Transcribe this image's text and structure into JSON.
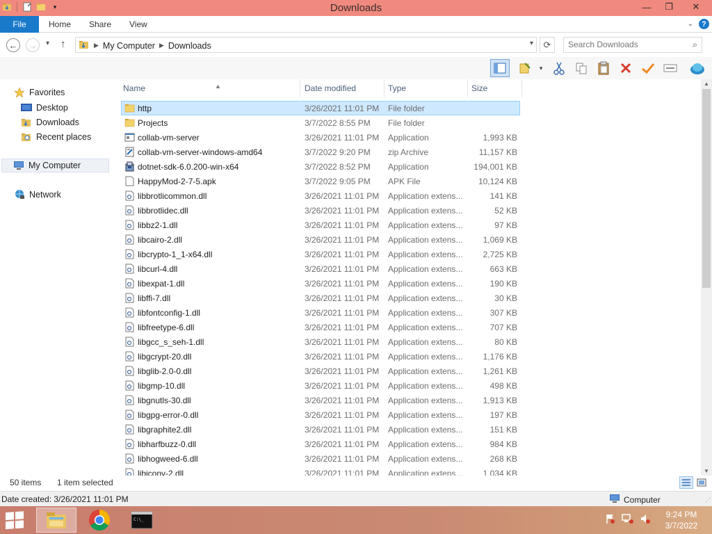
{
  "window": {
    "title": "Downloads",
    "controls": {
      "minimize": "—",
      "maximize": "❐",
      "close": "✕"
    }
  },
  "ribbon": {
    "tabs": {
      "file": "File",
      "home": "Home",
      "share": "Share",
      "view": "View"
    }
  },
  "address": {
    "crumbs": [
      "My Computer",
      "Downloads"
    ]
  },
  "search": {
    "placeholder": "Search Downloads"
  },
  "nav": {
    "favorites": "Favorites",
    "desktop": "Desktop",
    "downloads": "Downloads",
    "recent_places": "Recent places",
    "my_computer": "My Computer",
    "network": "Network"
  },
  "columns": {
    "name": "Name",
    "date": "Date modified",
    "type": "Type",
    "size": "Size"
  },
  "files": [
    {
      "name": "http",
      "date": "3/26/2021 11:01 PM",
      "type": "File folder",
      "size": "",
      "icon": "folder",
      "selected": true
    },
    {
      "name": "Projects",
      "date": "3/7/2022 8:55 PM",
      "type": "File folder",
      "size": "",
      "icon": "folder"
    },
    {
      "name": "collab-vm-server",
      "date": "3/26/2021 11:01 PM",
      "type": "Application",
      "size": "1,993 KB",
      "icon": "app"
    },
    {
      "name": "collab-vm-server-windows-amd64",
      "date": "3/7/2022 9:20 PM",
      "type": "zip Archive",
      "size": "11,157 KB",
      "icon": "zip"
    },
    {
      "name": "dotnet-sdk-6.0.200-win-x64",
      "date": "3/7/2022 8:52 PM",
      "type": "Application",
      "size": "194,001 KB",
      "icon": "installer"
    },
    {
      "name": "HappyMod-2-7-5.apk",
      "date": "3/7/2022 9:05 PM",
      "type": "APK File",
      "size": "10,124 KB",
      "icon": "file"
    },
    {
      "name": "libbrotlicommon.dll",
      "date": "3/26/2021 11:01 PM",
      "type": "Application extens...",
      "size": "141 KB",
      "icon": "dll"
    },
    {
      "name": "libbrotlidec.dll",
      "date": "3/26/2021 11:01 PM",
      "type": "Application extens...",
      "size": "52 KB",
      "icon": "dll"
    },
    {
      "name": "libbz2-1.dll",
      "date": "3/26/2021 11:01 PM",
      "type": "Application extens...",
      "size": "97 KB",
      "icon": "dll"
    },
    {
      "name": "libcairo-2.dll",
      "date": "3/26/2021 11:01 PM",
      "type": "Application extens...",
      "size": "1,069 KB",
      "icon": "dll"
    },
    {
      "name": "libcrypto-1_1-x64.dll",
      "date": "3/26/2021 11:01 PM",
      "type": "Application extens...",
      "size": "2,725 KB",
      "icon": "dll"
    },
    {
      "name": "libcurl-4.dll",
      "date": "3/26/2021 11:01 PM",
      "type": "Application extens...",
      "size": "663 KB",
      "icon": "dll"
    },
    {
      "name": "libexpat-1.dll",
      "date": "3/26/2021 11:01 PM",
      "type": "Application extens...",
      "size": "190 KB",
      "icon": "dll"
    },
    {
      "name": "libffi-7.dll",
      "date": "3/26/2021 11:01 PM",
      "type": "Application extens...",
      "size": "30 KB",
      "icon": "dll"
    },
    {
      "name": "libfontconfig-1.dll",
      "date": "3/26/2021 11:01 PM",
      "type": "Application extens...",
      "size": "307 KB",
      "icon": "dll"
    },
    {
      "name": "libfreetype-6.dll",
      "date": "3/26/2021 11:01 PM",
      "type": "Application extens...",
      "size": "707 KB",
      "icon": "dll"
    },
    {
      "name": "libgcc_s_seh-1.dll",
      "date": "3/26/2021 11:01 PM",
      "type": "Application extens...",
      "size": "80 KB",
      "icon": "dll"
    },
    {
      "name": "libgcrypt-20.dll",
      "date": "3/26/2021 11:01 PM",
      "type": "Application extens...",
      "size": "1,176 KB",
      "icon": "dll"
    },
    {
      "name": "libglib-2.0-0.dll",
      "date": "3/26/2021 11:01 PM",
      "type": "Application extens...",
      "size": "1,261 KB",
      "icon": "dll"
    },
    {
      "name": "libgmp-10.dll",
      "date": "3/26/2021 11:01 PM",
      "type": "Application extens...",
      "size": "498 KB",
      "icon": "dll"
    },
    {
      "name": "libgnutls-30.dll",
      "date": "3/26/2021 11:01 PM",
      "type": "Application extens...",
      "size": "1,913 KB",
      "icon": "dll"
    },
    {
      "name": "libgpg-error-0.dll",
      "date": "3/26/2021 11:01 PM",
      "type": "Application extens...",
      "size": "197 KB",
      "icon": "dll"
    },
    {
      "name": "libgraphite2.dll",
      "date": "3/26/2021 11:01 PM",
      "type": "Application extens...",
      "size": "151 KB",
      "icon": "dll"
    },
    {
      "name": "libharfbuzz-0.dll",
      "date": "3/26/2021 11:01 PM",
      "type": "Application extens...",
      "size": "984 KB",
      "icon": "dll"
    },
    {
      "name": "libhogweed-6.dll",
      "date": "3/26/2021 11:01 PM",
      "type": "Application extens...",
      "size": "268 KB",
      "icon": "dll"
    },
    {
      "name": "libiconv-2.dll",
      "date": "3/26/2021 11:01 PM",
      "type": "Application extens...",
      "size": "1,034 KB",
      "icon": "dll"
    }
  ],
  "status": {
    "item_count": "50 items",
    "selection": "1 item selected"
  },
  "details": {
    "date_created": "Date created: 3/26/2021 11:01 PM",
    "location": "Computer"
  },
  "taskbar": {
    "time": "9:24 PM",
    "date": "3/7/2022"
  },
  "colors": {
    "title_bar": "#f08a7e",
    "file_tab": "#1979ca",
    "selection_bg": "#cde8ff",
    "selection_border": "#99d1ff"
  }
}
